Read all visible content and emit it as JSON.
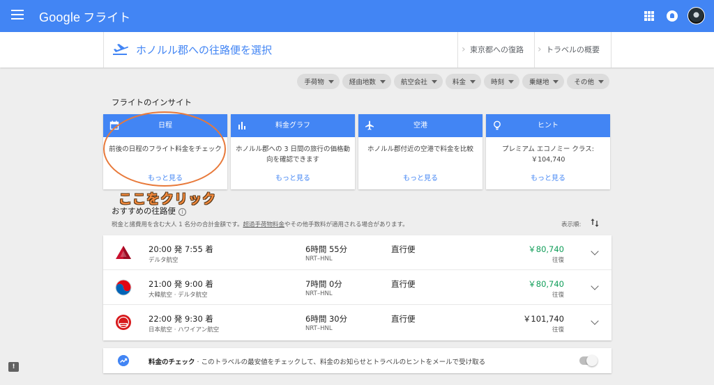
{
  "appbar": {
    "logo": "Google",
    "product": "フライト",
    "menu_icon": "menu-icon",
    "apps_icon": "apps-grid-icon",
    "notifications_icon": "notifications-icon"
  },
  "header": {
    "title": "ホノルル郡への往路便を選択",
    "crumbs": [
      "東京都への復路",
      "トラベルの概要"
    ]
  },
  "filters": [
    "手荷物",
    "経由地数",
    "航空会社",
    "料金",
    "時刻",
    "乗継地",
    "その他"
  ],
  "insights": {
    "title": "フライトのインサイト",
    "cards": [
      {
        "icon": "calendar-icon",
        "title": "日程",
        "body": "前後の日程のフライト料金をチェック",
        "more": "もっと見る"
      },
      {
        "icon": "bar-chart-icon",
        "title": "料金グラフ",
        "body": "ホノルル郡への 3 日間の旅行の価格動向を確認できます",
        "more": "もっと見る"
      },
      {
        "icon": "airplane-icon",
        "title": "空港",
        "body": "ホノルル郡付近の空港で料金を比較",
        "more": "もっと見る"
      },
      {
        "icon": "lightbulb-icon",
        "title": "ヒント",
        "body": "プレミアム エコノミー クラス:",
        "body2": "￥104,740",
        "more": "もっと見る"
      }
    ]
  },
  "annotation": {
    "text": "ここをクリック"
  },
  "recommended": {
    "title": "おすすめの往路便",
    "note_before": "税金と諸費用を含む大人 1 名分の合計金額です。",
    "note_link": "超過手荷物料金",
    "note_after": "やその他手数料が適用される場合があります。",
    "sort_label": "表示順:"
  },
  "flights": [
    {
      "logo": "delta-logo",
      "time": "20:00 発 7:55 着",
      "airline": "デルタ航空",
      "duration": "6時間 55分",
      "route": "NRT–HNL",
      "stops": "直行便",
      "price": "￥80,740",
      "price_color": "#0f9d58",
      "trip": "往復"
    },
    {
      "logo": "korean-air-logo",
      "time": "21:00 発 9:00 着",
      "airline": "大韓航空 · デルタ航空",
      "duration": "7時間 0分",
      "route": "NRT–HNL",
      "stops": "直行便",
      "price": "￥80,740",
      "price_color": "#0f9d58",
      "trip": "往復"
    },
    {
      "logo": "jal-logo",
      "time": "22:00 発 9:30 着",
      "airline": "日本航空 · ハワイアン航空",
      "duration": "6時間 30分",
      "route": "NRT–HNL",
      "stops": "直行便",
      "price": "￥101,740",
      "price_color": "#212121",
      "trip": "往復"
    }
  ],
  "tracking": {
    "label": "料金のチェック",
    "text": " · このトラベルの最安値をチェックして、料金のお知らせとトラベルのヒントをメールで受け取る",
    "enabled": false
  }
}
